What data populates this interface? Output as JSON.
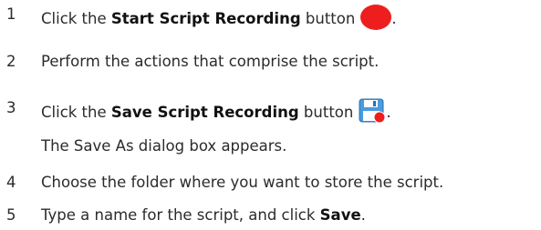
{
  "steps": [
    {
      "number": "1",
      "pre": "Click the ",
      "bold": "Start Script Recording",
      "post": " button",
      "icon": "record-icon",
      "tail": "."
    },
    {
      "number": "2",
      "text": "Perform the actions that comprise the script."
    },
    {
      "number": "3",
      "pre": "Click the ",
      "bold": "Save Script Recording",
      "post": " button",
      "icon": "save-recording-icon",
      "tail": ".",
      "note": "The Save As dialog box appears."
    },
    {
      "number": "4",
      "text": "Choose the folder where you want to store the script."
    },
    {
      "number": "5",
      "pre": "Type a name for the script, and click ",
      "bold": "Save",
      "tail": "."
    }
  ],
  "colors": {
    "record": "#ee1e1e",
    "floppy": "#4a9be0",
    "text": "#2b2b2b"
  }
}
